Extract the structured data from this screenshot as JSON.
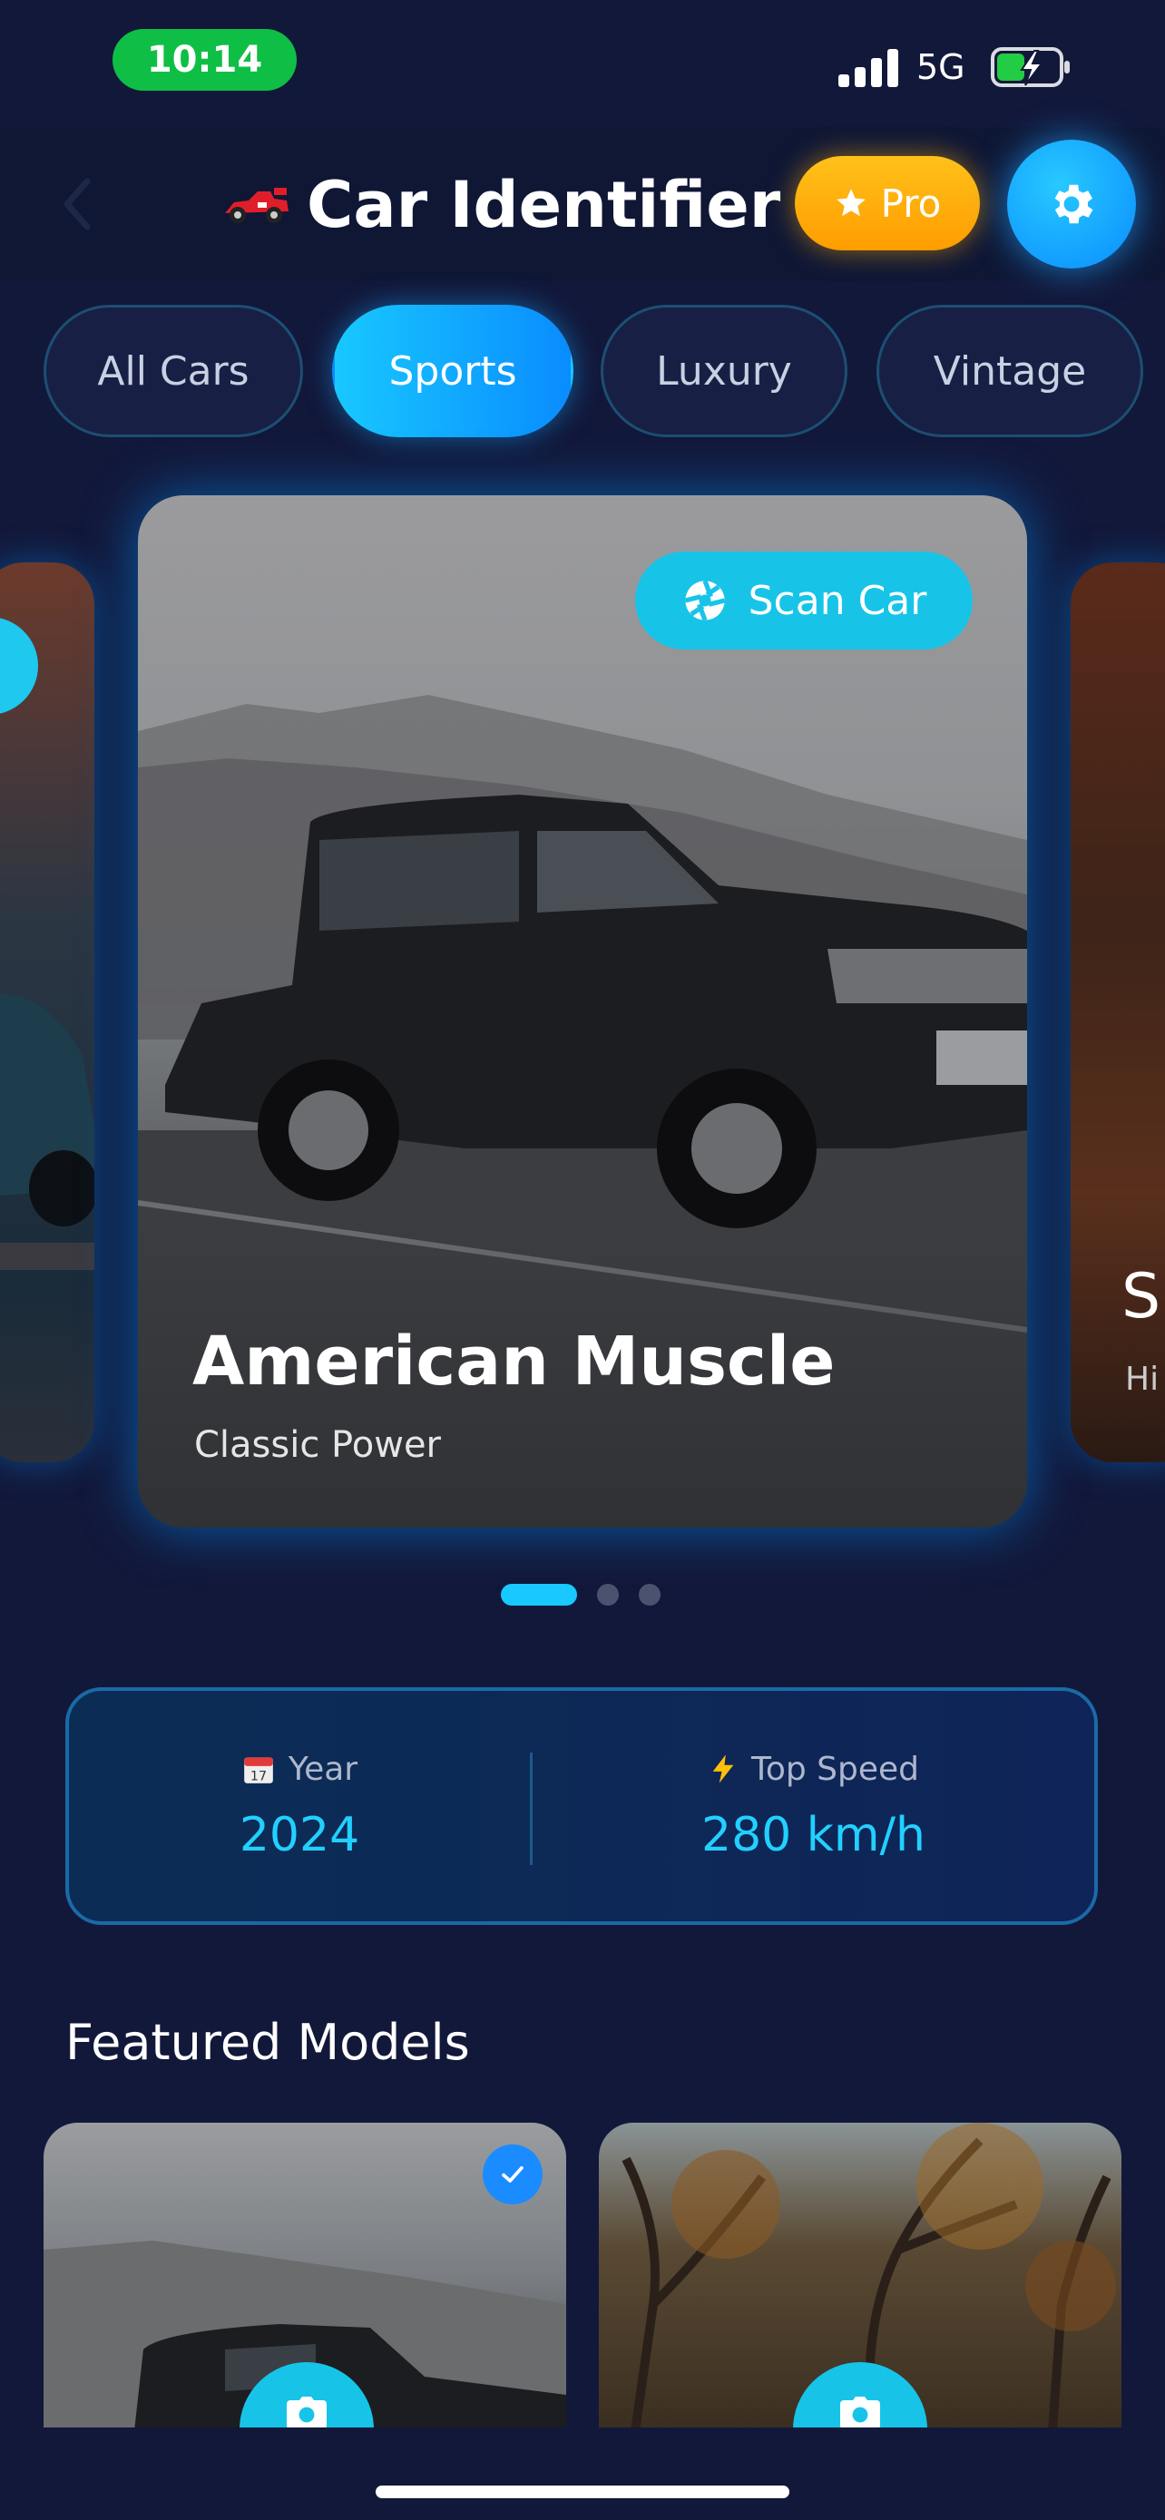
{
  "status_bar": {
    "time": "10:14",
    "network": "5G",
    "battery_color": "#22cc44"
  },
  "header": {
    "title": "Car Identifier",
    "title_icon": "race-car-icon",
    "pro_label": "Pro",
    "back_icon": "chevron-left-icon",
    "settings_icon": "gear-icon"
  },
  "tabs": [
    {
      "label": "All Cars",
      "active": false
    },
    {
      "label": "Sports",
      "active": true
    },
    {
      "label": "Luxury",
      "active": false
    },
    {
      "label": "Vintage",
      "active": false
    }
  ],
  "carousel": {
    "main_card": {
      "title": "American Muscle",
      "subtitle": "Classic Power",
      "scan_label": "Scan Car"
    },
    "next_card": {
      "title_partial": "S",
      "subtitle_partial": "Hi"
    },
    "page_count": 3,
    "active_page": 1
  },
  "stats": {
    "year_label": "Year",
    "year_value": "2024",
    "year_icon": "calendar-icon",
    "speed_label": "Top Speed",
    "speed_value": "280 km/h",
    "speed_icon": "lightning-icon"
  },
  "featured": {
    "title": "Featured Models",
    "items": [
      {
        "selected": true
      },
      {
        "selected": false
      }
    ]
  },
  "colors": {
    "background": "#12183a",
    "accent": "#18c8ff",
    "pro": "#ffb300"
  }
}
